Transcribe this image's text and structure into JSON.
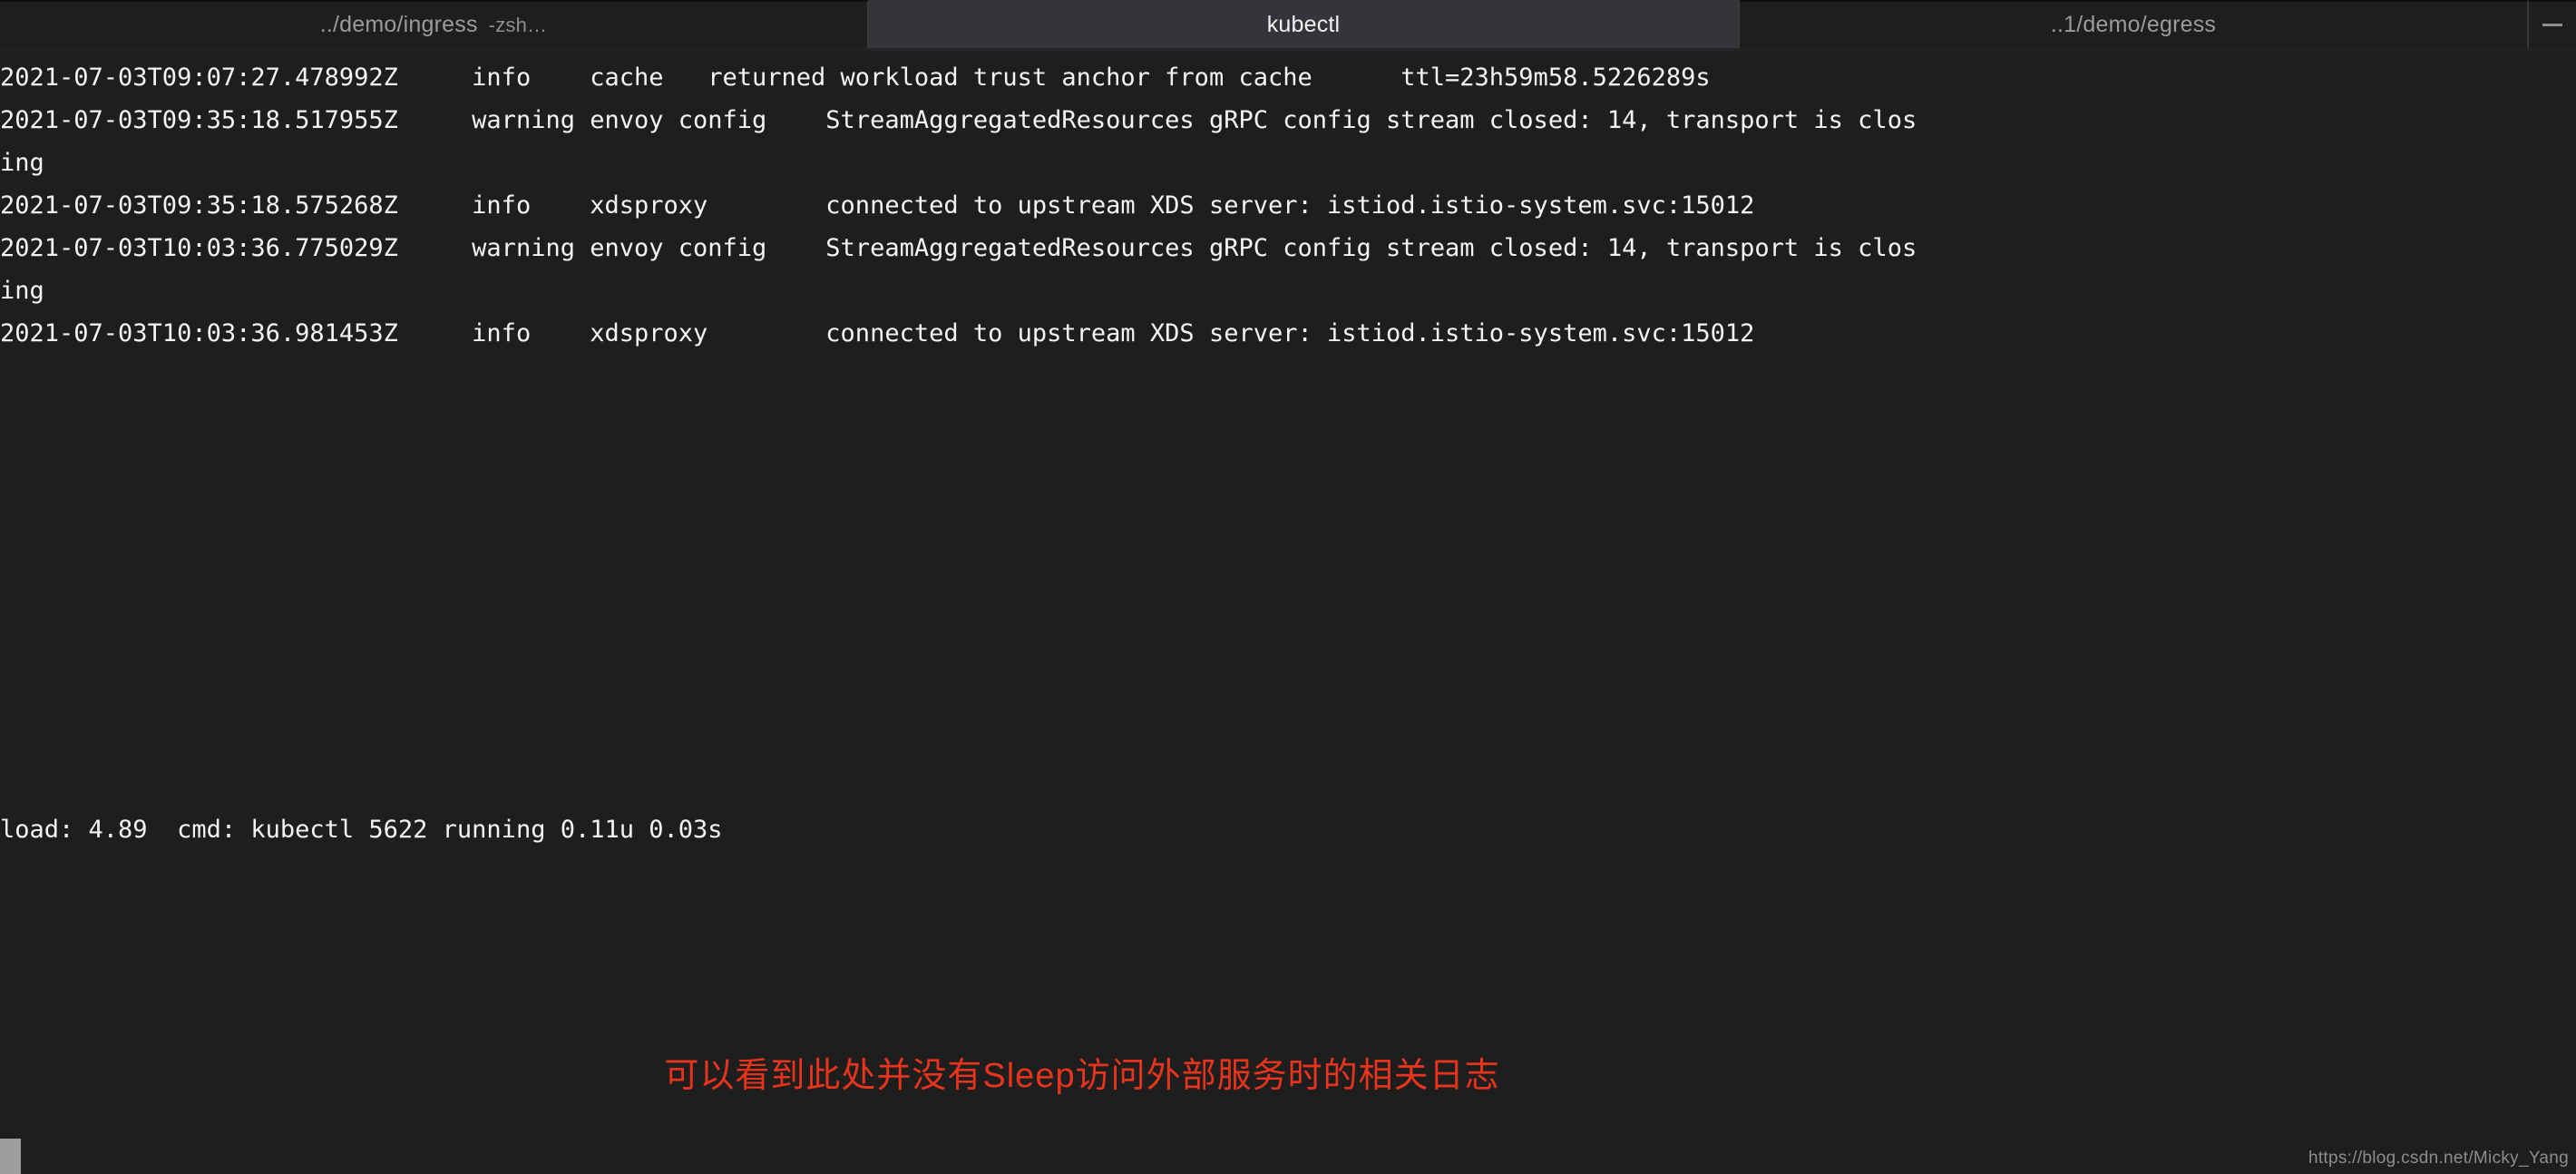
{
  "window": {
    "app": "Terminal",
    "active_tab": "kubectl"
  },
  "tabbar": {
    "tabs": [
      {
        "title": "../demo/ingress",
        "subtitle": "-zsh…",
        "active": false
      },
      {
        "title": "kubectl",
        "subtitle": "",
        "active": true
      },
      {
        "title": "..1/demo/egress",
        "subtitle": "",
        "active": false
      }
    ],
    "overflow_icon": "minus-icon"
  },
  "terminal": {
    "log_text": "2021-07-03T09:07:27.478992Z     info    cache   returned workload trust anchor from cache      ttl=23h59m58.5226289s\n2021-07-03T09:35:18.517955Z     warning envoy config    StreamAggregatedResources gRPC config stream closed: 14, transport is clos\ning\n2021-07-03T09:35:18.575268Z     info    xdsproxy        connected to upstream XDS server: istiod.istio-system.svc:15012\n2021-07-03T10:03:36.775029Z     warning envoy config    StreamAggregatedResources gRPC config stream closed: 14, transport is clos\ning\n2021-07-03T10:03:36.981453Z     info    xdsproxy        connected to upstream XDS server: istiod.istio-system.svc:15012",
    "log_lines": [
      {
        "timestamp": "2021-07-03T09:07:27.478992Z",
        "level": "info",
        "scope": "cache",
        "message": "returned workload trust anchor from cache",
        "extra": "ttl=23h59m58.5226289s"
      },
      {
        "timestamp": "2021-07-03T09:35:18.517955Z",
        "level": "warning",
        "scope": "envoy config",
        "message": "StreamAggregatedResources gRPC config stream closed: 14, transport is closing",
        "extra": ""
      },
      {
        "timestamp": "2021-07-03T09:35:18.575268Z",
        "level": "info",
        "scope": "xdsproxy",
        "message": "connected to upstream XDS server: istiod.istio-system.svc:15012",
        "extra": ""
      },
      {
        "timestamp": "2021-07-03T10:03:36.775029Z",
        "level": "warning",
        "scope": "envoy config",
        "message": "StreamAggregatedResources gRPC config stream closed: 14, transport is closing",
        "extra": ""
      },
      {
        "timestamp": "2021-07-03T10:03:36.981453Z",
        "level": "info",
        "scope": "xdsproxy",
        "message": "connected to upstream XDS server: istiod.istio-system.svc:15012",
        "extra": ""
      }
    ],
    "status_line": "load: 4.89  cmd: kubectl 5622 running 0.11u 0.03s",
    "cursor": "block-cursor"
  },
  "annotation": {
    "text": "可以看到此处并没有Sleep访问外部服务时的相关日志",
    "color": "#e8341c"
  },
  "watermark": {
    "text": "https://blog.csdn.net/Micky_Yang"
  },
  "colors": {
    "terminal_bg": "#1e1e1e",
    "tab_inactive_bg": "#1e1e1e",
    "tab_active_bg": "#343539",
    "text": "#f4f4f4",
    "tab_inactive_text": "#9b9b9b",
    "accent_red": "#e8341c",
    "cursor": "#9d9d9d"
  }
}
